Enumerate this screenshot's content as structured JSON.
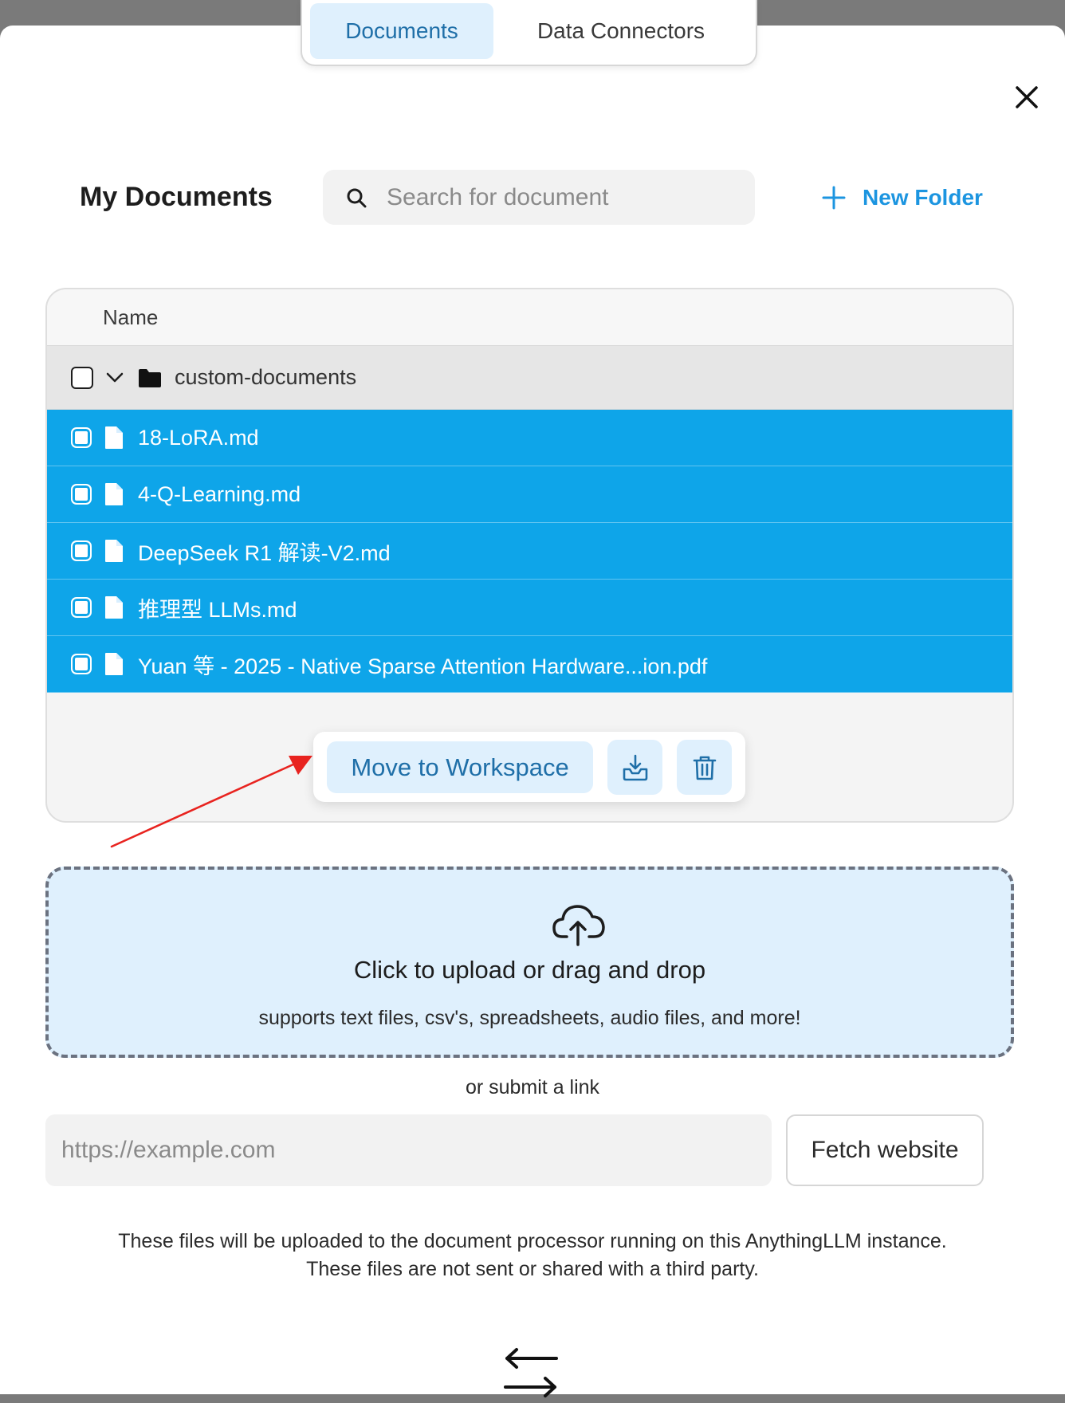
{
  "tabs": [
    {
      "label": "Documents",
      "active": true
    },
    {
      "label": "Data Connectors",
      "active": false
    }
  ],
  "header": {
    "title": "My Documents",
    "search_placeholder": "Search for document",
    "new_folder_label": "New Folder"
  },
  "table": {
    "column_name": "Name",
    "folder": {
      "name": "custom-documents",
      "checked": false,
      "expanded": true
    },
    "files": [
      {
        "name": "18-LoRA.md",
        "selected": true
      },
      {
        "name": "4-Q-Learning.md",
        "selected": true
      },
      {
        "name": "DeepSeek R1 解读-V2.md",
        "selected": true
      },
      {
        "name": "推理型 LLMs.md",
        "selected": true
      },
      {
        "name": "Yuan 等 - 2025 - Native Sparse Attention Hardware...ion.pdf",
        "selected": true
      }
    ]
  },
  "actions": {
    "move_label": "Move to Workspace",
    "download_icon": "download-tray-icon",
    "delete_icon": "trash-icon"
  },
  "upload": {
    "title": "Click to upload or drag and drop",
    "subtitle": "supports text files, csv's, spreadsheets, audio files, and more!",
    "or_link": "or submit a link",
    "url_placeholder": "https://example.com",
    "fetch_label": "Fetch website",
    "notice_line1": "These files will be uploaded to the document processor running on this AnythingLLM instance.",
    "notice_line2": "These files are not sent or shared with a third party."
  },
  "colors": {
    "selected_row": "#0ea5e9",
    "accent_blue": "#1c95e0",
    "light_blue": "#dff0fd",
    "annotation_arrow": "#e8231f"
  }
}
